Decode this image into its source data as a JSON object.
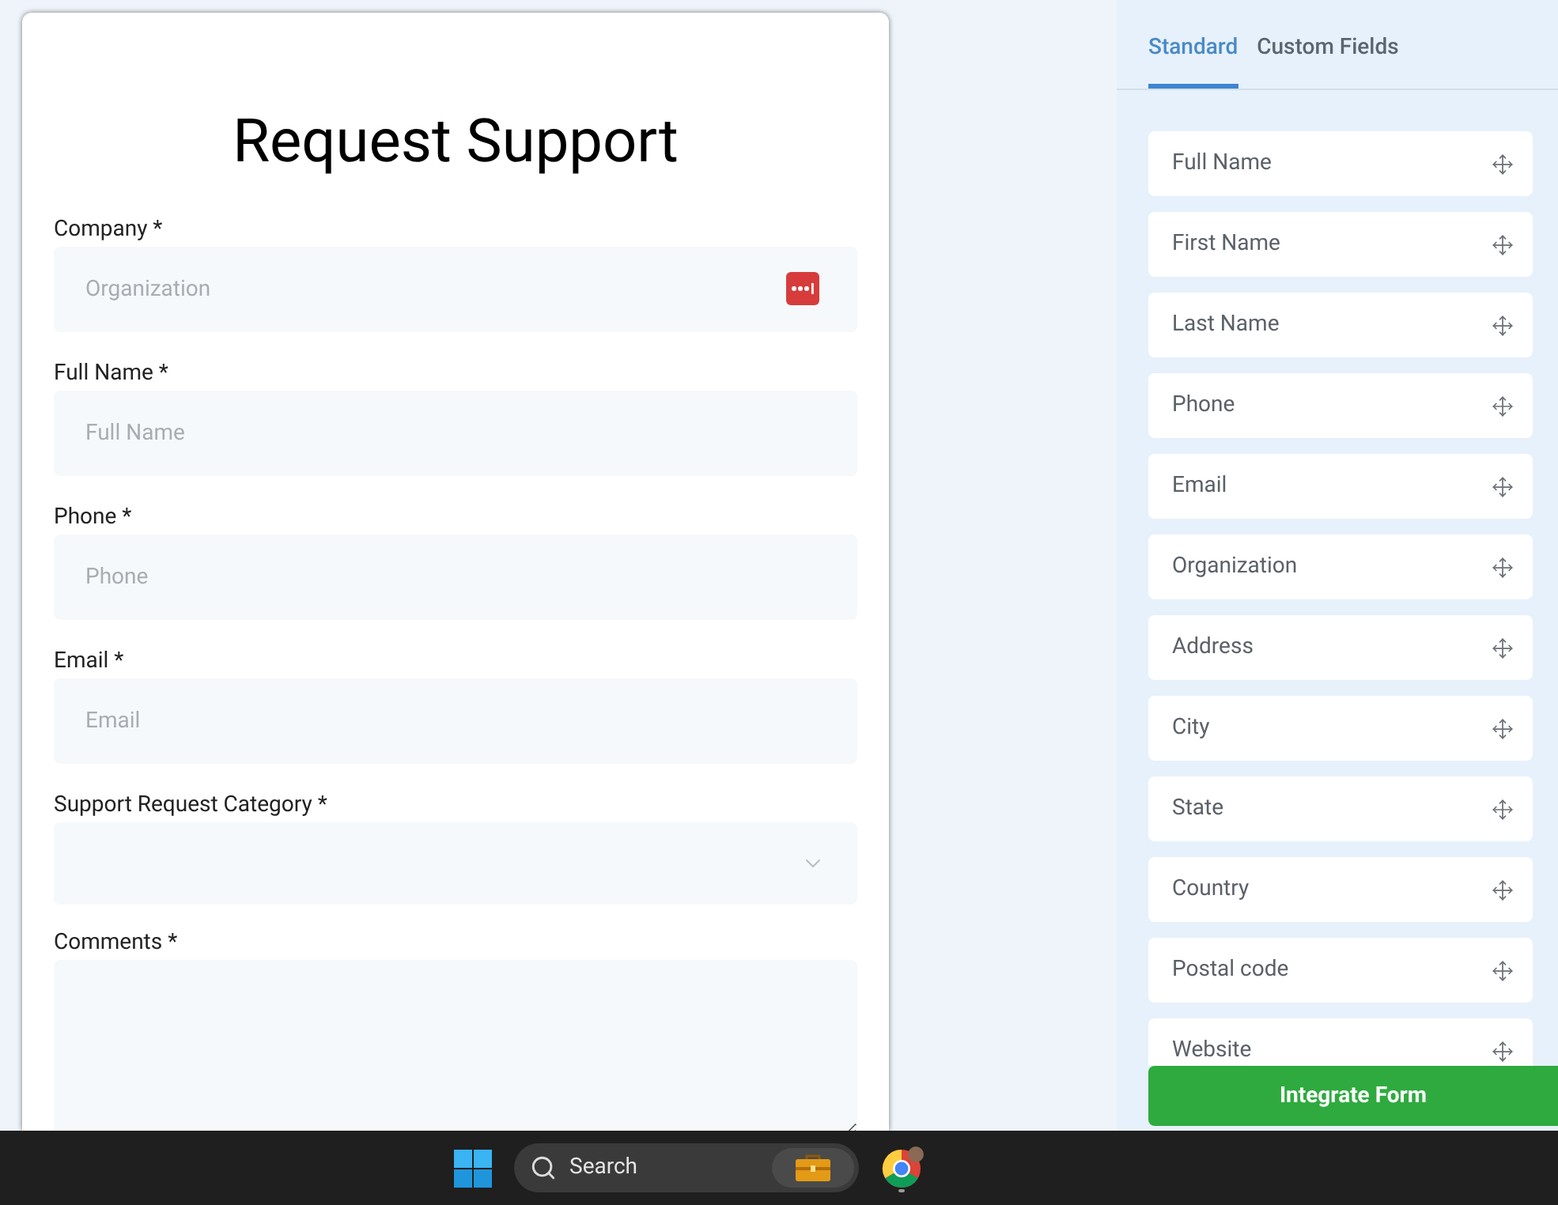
{
  "form": {
    "title": "Request Support",
    "fields": [
      {
        "kind": "text",
        "label": "Company *",
        "placeholder": "Organization",
        "autofill_icon": true
      },
      {
        "kind": "text",
        "label": "Full Name *",
        "placeholder": "Full Name",
        "autofill_icon": false
      },
      {
        "kind": "text",
        "label": "Phone *",
        "placeholder": "Phone",
        "autofill_icon": false
      },
      {
        "kind": "text",
        "label": "Email *",
        "placeholder": "Email",
        "autofill_icon": false
      },
      {
        "kind": "select",
        "label": "Support Request Category *"
      },
      {
        "kind": "textarea",
        "label": "Comments *"
      }
    ]
  },
  "panel": {
    "tabs": [
      {
        "label": "Standard",
        "selected": true
      },
      {
        "label": "Custom Fields",
        "selected": false
      }
    ],
    "items": [
      "Full Name",
      "First Name",
      "Last Name",
      "Phone",
      "Email",
      "Organization",
      "Address",
      "City",
      "State",
      "Country",
      "Postal code",
      "Website"
    ],
    "button": "Integrate Form"
  },
  "taskbar": {
    "search": {
      "placeholder": "Search"
    }
  }
}
